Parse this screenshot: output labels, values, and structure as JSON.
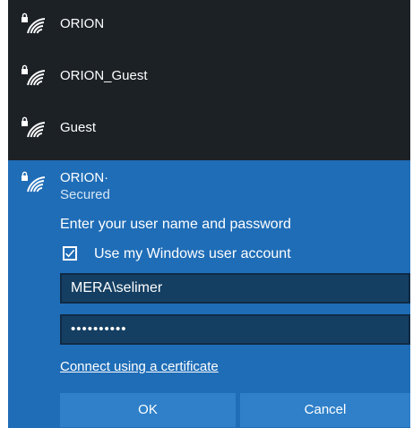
{
  "networks": [
    {
      "name": "ORION",
      "icon": "secured-wifi-icon"
    },
    {
      "name": "ORION_Guest",
      "icon": "secured-wifi-icon"
    },
    {
      "name": "Guest",
      "icon": "secured-wifi-icon"
    }
  ],
  "selected_network": {
    "name": "ORION·",
    "status": "Secured",
    "prompt": "Enter your user name and password",
    "use_windows_account": {
      "label": "Use my Windows user account",
      "checked": true
    },
    "username_value": "MERA\\selimer",
    "password_value": "••••••••••",
    "certificate_link": "Connect using a certificate",
    "ok_label": "OK",
    "cancel_label": "Cancel"
  },
  "colors": {
    "panel_background": "#1c2126",
    "selected_background": "#1f6db7",
    "field_background": "#153f62",
    "button_background": "#2f80c9",
    "text": "#ffffff"
  }
}
